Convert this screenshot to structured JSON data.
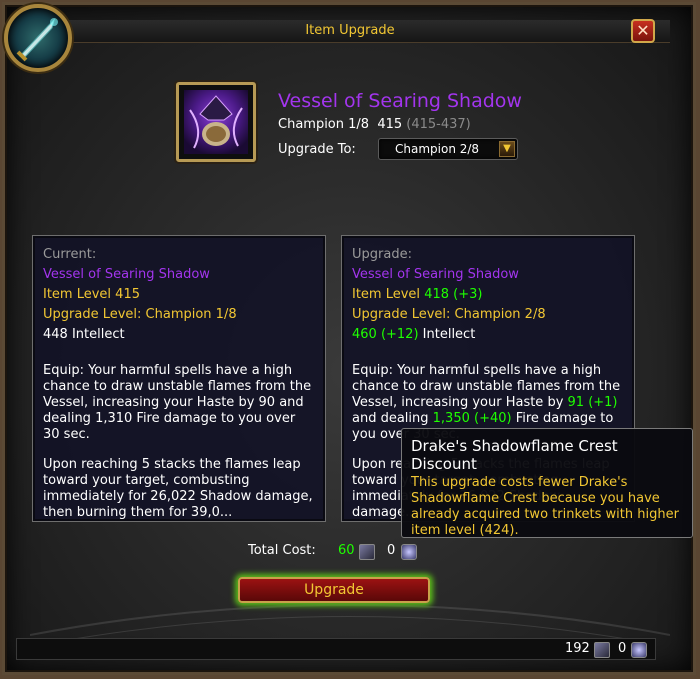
{
  "window": {
    "title": "Item Upgrade",
    "close_label": "✕"
  },
  "item": {
    "name": "Vessel of Searing Shadow",
    "track": "Champion 1/8",
    "ilvl": "415",
    "range": "(415-437)",
    "upgrade_to_label": "Upgrade To:",
    "upgrade_to_value": "Champion 2/8"
  },
  "current": {
    "header": "Current:",
    "name": "Vessel of Searing Shadow",
    "item_level": "Item Level 415",
    "upgrade_level": "Upgrade Level: Champion 1/8",
    "stat": "448 Intellect",
    "equip": "Equip: Your harmful spells have a high chance to draw unstable flames from the Vessel, increasing your Haste by 90 and dealing 1,310 Fire damage to you over 30 sec.",
    "stacks": "Upon reaching 5 stacks the flames leap toward your target, combusting immediately for 26,022 Shadow damage, then burning them for 39,0..."
  },
  "upgrade": {
    "header": "Upgrade:",
    "name": "Vessel of Searing Shadow",
    "item_level_prefix": "Item Level ",
    "item_level_value": "418 (+3)",
    "upgrade_level": "Upgrade Level: Champion 2/8",
    "stat_value": "460 (+12)",
    "stat_suffix": " Intellect",
    "equip_a": "Equip: Your harmful spells have a high chance to draw unstable flames from the Vessel, increasing your Haste by ",
    "haste_value": "91 (+1)",
    "equip_b": " and dealing ",
    "fire_value": "1,350 (+40)",
    "equip_c": " Fire damage to you over 30 sec.",
    "stacks_visible": "Upon reaching 5 stacks the flames leap toward your target, combusting immediately for 26,022 Shadow damage..."
  },
  "tooltip": {
    "title": "Drake's Shadowflame Crest Discount",
    "text": "This upgrade costs fewer Drake's Shadowflame Crest because you have already acquired two trinkets with higher item level (424)."
  },
  "cost": {
    "label": "Total Cost:",
    "crest": "60",
    "shadow": "0"
  },
  "button": {
    "upgrade": "Upgrade"
  },
  "currency": {
    "crests": "192",
    "flightstones": "0"
  }
}
